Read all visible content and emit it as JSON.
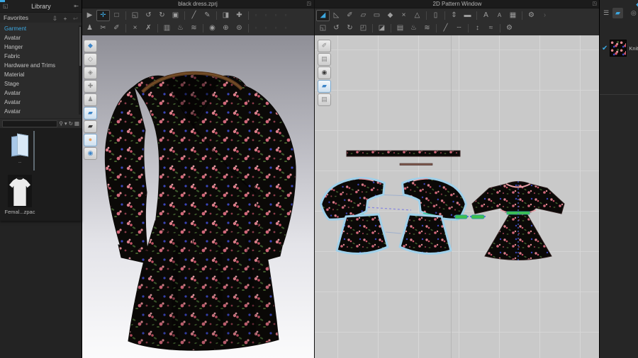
{
  "colors": {
    "accent": "#3ba7e0",
    "selection_outline": "#9fd0ea",
    "grid_background": "#c9c9c9",
    "green_strip": "#3ec24e",
    "panel_dark": "#262626"
  },
  "library": {
    "header": {
      "title": "Library",
      "float_icon": "◱",
      "pin_icon": "⇤"
    },
    "favorites": {
      "label": "Favorites",
      "download_icon": "⇩",
      "add_icon": "+",
      "back_icon": "↩"
    },
    "items": [
      {
        "label": "Garment",
        "cls": "selected",
        "n": "sidebar-item-garment",
        "it": "true"
      },
      {
        "label": "Avatar",
        "cls": "",
        "n": "sidebar-item-avatar",
        "it": "true"
      },
      {
        "label": "Hanger",
        "cls": "",
        "n": "sidebar-item-hanger",
        "it": "true"
      },
      {
        "label": "Fabric",
        "cls": "",
        "n": "sidebar-item-fabric",
        "it": "true"
      },
      {
        "label": "Hardware and Trims",
        "cls": "",
        "n": "sidebar-item-hardware-and-trims",
        "it": "true"
      },
      {
        "label": "Material",
        "cls": "",
        "n": "sidebar-item-material",
        "it": "true"
      },
      {
        "label": "Stage",
        "cls": "",
        "n": "sidebar-item-stage",
        "it": "true"
      },
      {
        "label": "Avatar",
        "cls": "",
        "n": "sidebar-item-avatar-2",
        "it": "true"
      },
      {
        "label": "Avatar",
        "cls": "",
        "n": "sidebar-item-avatar-3",
        "it": "true"
      },
      {
        "label": "Avatar",
        "cls": "",
        "n": "sidebar-item-avatar-4",
        "it": "true"
      }
    ],
    "search": {
      "magnifier": "⚲",
      "dropdown": "▾",
      "refresh": "↻",
      "view": "▦"
    },
    "files": [
      {
        "label": ".."
      },
      {
        "label": "Femal...zpac"
      }
    ]
  },
  "v3d": {
    "title": "black dress.zprj",
    "float_icon": "◳"
  },
  "v2d": {
    "title": "2D Pattern Window",
    "float_icon": "◳"
  },
  "fabric_panel": {
    "check": "✔",
    "label": "Knit",
    "overflow_icon": "◆"
  },
  "t3d_r1": [
    {
      "g": "▶",
      "cls": "",
      "n": "gizmo-tool",
      "it": "true"
    },
    {
      "g": "✛",
      "cls": "active",
      "n": "select-move-tool",
      "it": "true"
    },
    {
      "g": "□",
      "cls": "",
      "n": "select-box-tool",
      "it": "true"
    },
    {
      "g": "",
      "cls": "sep",
      "n": "separator",
      "it": "false"
    },
    {
      "g": "◱",
      "cls": "",
      "n": "move-pattern-tool",
      "it": "true"
    },
    {
      "g": "↺",
      "cls": "",
      "n": "rotate-ccw-tool",
      "it": "true"
    },
    {
      "g": "↻",
      "cls": "",
      "n": "rotate-cw-tool",
      "it": "true"
    },
    {
      "g": "▣",
      "cls": "",
      "n": "pin-tool",
      "it": "true"
    },
    {
      "g": "",
      "cls": "sep",
      "n": "separator",
      "it": "false"
    },
    {
      "g": "╱",
      "cls": "",
      "n": "sewing-tool",
      "it": "true"
    },
    {
      "g": "✎",
      "cls": "",
      "n": "free-sewing-tool",
      "it": "true"
    },
    {
      "g": "",
      "cls": "sep",
      "n": "separator",
      "it": "false"
    },
    {
      "g": "◨",
      "cls": "",
      "n": "fold-arrangement-tool",
      "it": "true"
    },
    {
      "g": "✚",
      "cls": "",
      "n": "arrangement-points-tool",
      "it": "true"
    },
    {
      "g": "",
      "cls": "sep",
      "n": "separator",
      "it": "false"
    },
    {
      "g": "▫",
      "cls": "disabled",
      "n": "disabled-tool",
      "it": "false"
    },
    {
      "g": "▫",
      "cls": "disabled",
      "n": "disabled-tool",
      "it": "false"
    },
    {
      "g": "▫",
      "cls": "disabled",
      "n": "disabled-tool",
      "it": "false"
    },
    {
      "g": "▫",
      "cls": "disabled",
      "n": "disabled-tool",
      "it": "false"
    }
  ],
  "t3d_r2": [
    {
      "g": "♟",
      "cls": "",
      "n": "avatar-walk-tool",
      "it": "true"
    },
    {
      "g": "✂",
      "cls": "",
      "n": "sculpt-tool",
      "it": "true"
    },
    {
      "g": "✐",
      "cls": "",
      "n": "tack-tool",
      "it": "true"
    },
    {
      "g": "",
      "cls": "sep",
      "n": "separator",
      "it": "false"
    },
    {
      "g": "×",
      "cls": "",
      "n": "pinch-tool",
      "it": "true"
    },
    {
      "g": "✗",
      "cls": "",
      "n": "smooth-tool",
      "it": "true"
    },
    {
      "g": "",
      "cls": "sep",
      "n": "separator",
      "it": "false"
    },
    {
      "g": "▥",
      "cls": "",
      "n": "fitting-map-tool",
      "it": "true"
    },
    {
      "g": "♨",
      "cls": "",
      "n": "steam-tool",
      "it": "true"
    },
    {
      "g": "≋",
      "cls": "",
      "n": "wrinkle-tool",
      "it": "true"
    },
    {
      "g": "",
      "cls": "sep",
      "n": "separator",
      "it": "false"
    },
    {
      "g": "◉",
      "cls": "",
      "n": "button-tool",
      "it": "true"
    },
    {
      "g": "⊕",
      "cls": "",
      "n": "buttonhole-tool",
      "it": "true"
    },
    {
      "g": "⊜",
      "cls": "",
      "n": "zipper-tool",
      "it": "true"
    },
    {
      "g": "",
      "cls": "sep",
      "n": "separator",
      "it": "false"
    },
    {
      "g": "▫",
      "cls": "disabled",
      "n": "disabled-tool",
      "it": "false"
    },
    {
      "g": "▫",
      "cls": "disabled",
      "n": "disabled-tool",
      "it": "false"
    },
    {
      "g": "▫",
      "cls": "disabled",
      "n": "disabled-tool",
      "it": "false"
    },
    {
      "g": "▫",
      "cls": "disabled",
      "n": "disabled-tool",
      "it": "false"
    }
  ],
  "t2d_r1": [
    {
      "g": "◢",
      "cls": "active",
      "n": "transform-pattern-tool",
      "it": "true"
    },
    {
      "g": "◺",
      "cls": "",
      "n": "edit-pattern-tool",
      "it": "true"
    },
    {
      "g": "✐",
      "cls": "",
      "n": "edit-curvature-tool",
      "it": "true"
    },
    {
      "g": "▱",
      "cls": "",
      "n": "polygon-tool",
      "it": "true"
    },
    {
      "g": "▭",
      "cls": "",
      "n": "rectangle-tool",
      "it": "true"
    },
    {
      "g": "◆",
      "cls": "",
      "n": "dart-tool",
      "it": "true"
    },
    {
      "g": "×",
      "cls": "",
      "n": "edit-seam-tool",
      "it": "true"
    },
    {
      "g": "△",
      "cls": "",
      "n": "trace-tool",
      "it": "true"
    },
    {
      "g": "",
      "cls": "sep",
      "n": "separator",
      "it": "false"
    },
    {
      "g": "▯",
      "cls": "",
      "n": "grading-tool",
      "it": "true"
    },
    {
      "g": "",
      "cls": "sep",
      "n": "separator",
      "it": "false"
    },
    {
      "g": "⇕",
      "cls": "",
      "n": "segment-sewing-tool",
      "it": "true"
    },
    {
      "g": "▬",
      "cls": "",
      "n": "free-sewing-2d-tool",
      "it": "true"
    },
    {
      "g": "",
      "cls": "sep",
      "n": "separator",
      "it": "false"
    },
    {
      "g": "A",
      "cls": "",
      "n": "pattern-annotation-tool",
      "it": "true"
    },
    {
      "g": "A",
      "cls": "smallA",
      "n": "pattern-text-tool",
      "it": "true"
    },
    {
      "g": "▦",
      "cls": "",
      "n": "pleats-tool",
      "it": "true"
    },
    {
      "g": "",
      "cls": "sep",
      "n": "separator",
      "it": "false"
    },
    {
      "g": "⚙",
      "cls": "",
      "n": "sewing-machine-tool",
      "it": "true"
    },
    {
      "g": "›",
      "cls": "dim",
      "n": "toolbar-overflow-icon",
      "it": "true"
    }
  ],
  "t2d_r2": [
    {
      "g": "◱",
      "cls": "",
      "n": "move-2d-tool",
      "it": "true"
    },
    {
      "g": "↺",
      "cls": "",
      "n": "rotate-2d-ccw-tool",
      "it": "true"
    },
    {
      "g": "↻",
      "cls": "",
      "n": "rotate-2d-cw-tool",
      "it": "true"
    },
    {
      "g": "◰",
      "cls": "",
      "n": "flip-tool",
      "it": "true"
    },
    {
      "g": "",
      "cls": "sep",
      "n": "separator",
      "it": "false"
    },
    {
      "g": "◪",
      "cls": "",
      "n": "iron-tool",
      "it": "true"
    },
    {
      "g": "",
      "cls": "sep",
      "n": "separator",
      "it": "false"
    },
    {
      "g": "▤",
      "cls": "",
      "n": "texture-tool",
      "it": "true"
    },
    {
      "g": "♨",
      "cls": "",
      "n": "steam-2d-tool",
      "it": "true"
    },
    {
      "g": "≋",
      "cls": "",
      "n": "shrinkage-tool",
      "it": "true"
    },
    {
      "g": "",
      "cls": "sep",
      "n": "separator",
      "it": "false"
    },
    {
      "g": "╱",
      "cls": "",
      "n": "measure-line-tool",
      "it": "true"
    },
    {
      "g": "┄",
      "cls": "",
      "n": "measure-dash-tool",
      "it": "true"
    },
    {
      "g": "",
      "cls": "sep",
      "n": "separator",
      "it": "false"
    },
    {
      "g": "↕",
      "cls": "",
      "n": "measure-height-tool",
      "it": "true"
    },
    {
      "g": "≈",
      "cls": "",
      "n": "measure-curve-tool",
      "it": "true"
    },
    {
      "g": "",
      "cls": "sep",
      "n": "separator",
      "it": "false"
    },
    {
      "g": "⚙",
      "cls": "",
      "n": "machine-2d-tool",
      "it": "true"
    }
  ],
  "side3d": [
    {
      "g": "◆",
      "cls": "blue",
      "n": "show-garment-icon",
      "it": "true"
    },
    {
      "g": "◇",
      "cls": "dim",
      "n": "show-pattern-mesh-icon",
      "it": "true"
    },
    {
      "g": "◈",
      "cls": "dim",
      "n": "fitting-suit-icon",
      "it": "true"
    },
    {
      "g": "✚",
      "cls": "dim",
      "n": "pin-view-icon",
      "it": "true"
    },
    {
      "g": "♟",
      "cls": "dim",
      "n": "avatar-pose-icon",
      "it": "true"
    },
    {
      "g": "▰",
      "cls": "blue hl",
      "n": "fabric-view-icon",
      "it": "true"
    },
    {
      "g": "▰",
      "cls": "dark",
      "n": "texture-surface-icon",
      "it": "true"
    },
    {
      "g": "●",
      "cls": "orange hl",
      "n": "show-avatar-icon",
      "it": "true"
    },
    {
      "g": "◉",
      "cls": "blue",
      "n": "environment-icon",
      "it": "true"
    }
  ],
  "side2d": [
    {
      "g": "✐",
      "cls": "dim",
      "n": "edit-texture-icon",
      "it": "true"
    },
    {
      "g": "▤",
      "cls": "dim",
      "n": "show-seamline-icon",
      "it": "true"
    },
    {
      "g": "◉",
      "cls": "dark",
      "n": "pattern-info-icon",
      "it": "true"
    },
    {
      "g": "▰",
      "cls": "blue hl",
      "n": "fabric-2d-icon",
      "it": "true"
    },
    {
      "g": "▤",
      "cls": "dim",
      "n": "lock-pattern-icon",
      "it": "true"
    }
  ],
  "rtabs": [
    {
      "g": "☰",
      "cls": "",
      "n": "object-list-tab",
      "it": "true"
    },
    {
      "g": "▰",
      "cls": "active",
      "n": "fabric-tab",
      "it": "true"
    },
    {
      "g": "◎",
      "cls": "edge",
      "n": "trim-tab",
      "it": "true"
    }
  ]
}
